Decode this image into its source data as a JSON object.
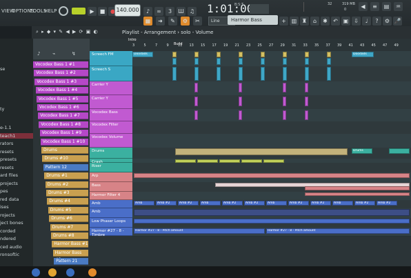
{
  "menu": [
    "VIEW",
    "OPTIONS",
    "TOOLS",
    "HELP"
  ],
  "transport": {
    "tempo": "140.000",
    "time": "1:01:00",
    "time_label": "B:S:T",
    "status_box": "Harmor Bass",
    "snap": "Line"
  },
  "meters": {
    "cpu": "32",
    "ram": "319 MB",
    "voices": "0"
  },
  "playlist_title": "Playlist - Arrangement  ›  solo - Volume",
  "ruler": [
    "3",
    "5",
    "7",
    "9",
    "11",
    "13",
    "15",
    "17",
    "19",
    "21",
    "23",
    "25",
    "27",
    "29",
    "31",
    "33",
    "35",
    "37",
    "39",
    "41",
    "43",
    "45",
    "47",
    "49"
  ],
  "markers": {
    "intro": "Intro",
    "build": "Build"
  },
  "browser": [
    "se",
    "ty",
    "e-1.1",
    "teach1",
    "rators",
    "resets",
    "presets",
    "resets",
    "ard files",
    "projects",
    "pes",
    "red data",
    "ises",
    "rojects",
    "ject bones",
    "corded",
    "ndered",
    "ced audio",
    "ronsoftic"
  ],
  "patterns": [
    {
      "label": "Vocodex Bass 1 #1",
      "color": "#b548c7"
    },
    {
      "label": "Vocodex Bass 1 #2",
      "color": "#b548c7"
    },
    {
      "label": "Vocodex Bass 1 #3",
      "color": "#b548c7"
    },
    {
      "label": "Vocodex Bass 1 #4",
      "color": "#b548c7"
    },
    {
      "label": "Vocodex Bass 1 #5",
      "color": "#b548c7"
    },
    {
      "label": "Vocodex Bass 1 #6",
      "color": "#b548c7"
    },
    {
      "label": "Vocodex Bass 1 #7",
      "color": "#b548c7"
    },
    {
      "label": "Vocodex Bass 1 #8",
      "color": "#b548c7"
    },
    {
      "label": "Vocodex Bass 1 #9",
      "color": "#b548c7"
    },
    {
      "label": "Vocodex Bass 1 #10",
      "color": "#b548c7"
    },
    {
      "label": "Drums",
      "color": "#c9a050"
    },
    {
      "label": "Drums #10",
      "color": "#c9a050"
    },
    {
      "label": "Pattern 12",
      "color": "#4a7bc4"
    },
    {
      "label": "Drums #1",
      "color": "#c9a050"
    },
    {
      "label": "Drums #2",
      "color": "#c9a050"
    },
    {
      "label": "Drums #3",
      "color": "#c9a050"
    },
    {
      "label": "Drums #4",
      "color": "#c9a050"
    },
    {
      "label": "Drums #5",
      "color": "#c9a050"
    },
    {
      "label": "Drums #6",
      "color": "#c9a050"
    },
    {
      "label": "Drums #7",
      "color": "#c9a050"
    },
    {
      "label": "Drums #8",
      "color": "#c9a050"
    },
    {
      "label": "Harmor Bass #1",
      "color": "#c9a050"
    },
    {
      "label": "Harmor Bass #2",
      "color": "#c9a050"
    },
    {
      "label": "Pattern 21",
      "color": "#4a7bc4"
    }
  ],
  "tracks": [
    {
      "name": "Screech FM",
      "color": "#3aa7c4"
    },
    {
      "name": "Screech S",
      "color": "#3aa7c4"
    },
    {
      "name": "Carrier Y",
      "color": "#c15ad1"
    },
    {
      "name": "Carrier Y",
      "color": "#c15ad1"
    },
    {
      "name": "Vocodex Bass",
      "color": "#c15ad1"
    },
    {
      "name": "Vocodex Filter",
      "color": "#c15ad1"
    },
    {
      "name": "Vocodex Volume",
      "color": "#c15ad1"
    },
    {
      "name": "Drums",
      "color": "#3bb0a0"
    },
    {
      "name": "Crash",
      "color": "#3bb0a0"
    },
    {
      "name": "Riser",
      "color": "#3bb0a0"
    },
    {
      "name": "Arp",
      "color": "#d78387"
    },
    {
      "name": "Bass",
      "color": "#d78387"
    },
    {
      "name": "Harmor Filter 4",
      "color": "#d78387"
    },
    {
      "name": "Amb",
      "color": "#4a6ec8"
    },
    {
      "name": "Amb",
      "color": "#4a6ec8"
    },
    {
      "name": "Low Phaser Loops",
      "color": "#4a6ec8"
    },
    {
      "name": "Harmor #27 - 8 - Timbre",
      "color": "#4a6ec8"
    }
  ],
  "clip_labels": {
    "doodads": "Doodads",
    "amb": "Amb",
    "amb2": "Amb #2",
    "drums": "Drums",
    "harmor": "Harmor #27 - 8 - Pitch amount"
  }
}
